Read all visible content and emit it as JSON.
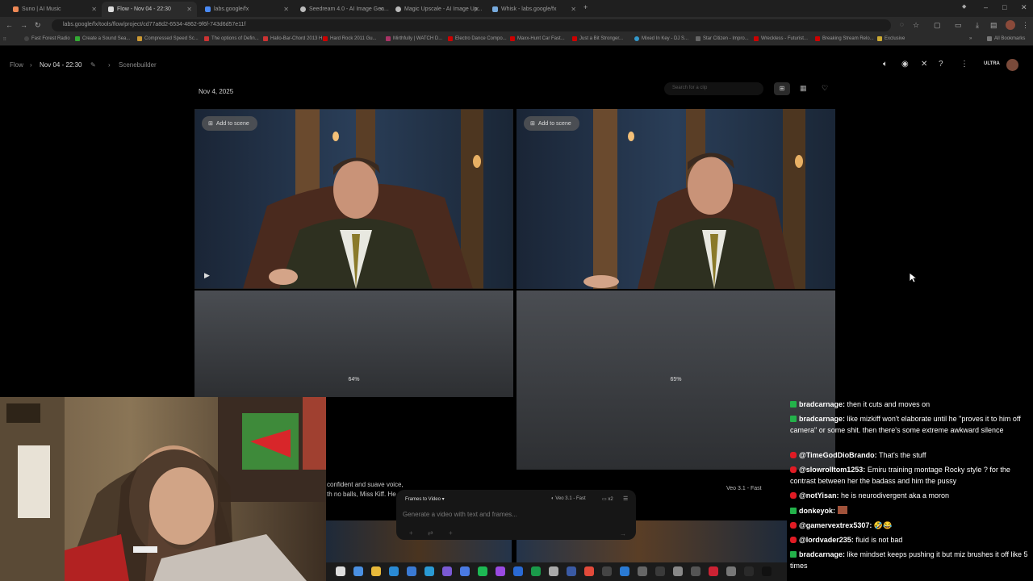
{
  "browser": {
    "tabs": [
      {
        "title": "Suno | AI Music",
        "active": false
      },
      {
        "title": "Flow - Nov 04 - 22:30",
        "active": true
      },
      {
        "title": "labs.google/fx",
        "active": false
      },
      {
        "title": "Seedream 4.0 - AI Image Gen...",
        "active": false
      },
      {
        "title": "Magic Upscale - AI Image Up...",
        "active": false
      },
      {
        "title": "Whisk - labs.google/fx",
        "active": false
      }
    ],
    "new_tab": "+",
    "url": "labs.google/fx/tools/flow/project/cd77a8d2-6534-4862-9f6f-743d6d57e11f",
    "bookmarks": [
      "Fast Forest Radio",
      "Create a Sound Sea...",
      "Compressed Speed Sc...",
      "The options of Defin...",
      "Hallo-Bar-Chord 2013 H...",
      "Hard Rock 2011 Gu...",
      "Mirthfully | WATCH D...",
      "Electro Dance Compo...",
      "Maxx-Hunt Car Fast...",
      "Just a Bit Stronger...",
      "Mixed In Key - DJ S...",
      "Star Citizen - Impro...",
      "Wreckless - Futurist...",
      "Breaking Stream Relo...",
      "Exclusive"
    ],
    "all_bookmarks": "All Bookmarks"
  },
  "app": {
    "breadcrumb": [
      "Flow",
      "Nov 04 - 22:30",
      "Scenebuilder"
    ],
    "date_label": "Nov 4, 2025",
    "search_placeholder": "Search for a clip",
    "badge": "ULTRA",
    "add_to_scene": "Add to scene",
    "progress": [
      {
        "label": "64%",
        "value": 64
      },
      {
        "label": "65%",
        "value": 65
      }
    ],
    "model_label": "Veo 3.1 - Fast",
    "overlay_text": [
      "confident and suave voice,",
      "th no balls, Miss Kiff. He"
    ],
    "prompt": {
      "mode": "Frames to Video",
      "model": "Veo 3.1 - Fast",
      "count": "x2",
      "placeholder": "Generate a video with text and frames..."
    }
  },
  "chat": [
    {
      "user": "bradcarnage:",
      "text": "then it cuts and moves on",
      "badge": "green"
    },
    {
      "user": "bradcarnage:",
      "text": "like mizkiff won't elaborate until he \"proves it to him off camera\" or some shit. then there's some extreme awkward silence",
      "badge": "green"
    },
    {
      "user": "@TimeGodDioBrando:",
      "text": "That's the stuff",
      "badge": "red"
    },
    {
      "user": "@slowrolltom1253:",
      "text": "Emiru training montage Rocky style ? for the contrast between her the badass and him the pussy",
      "badge": "red"
    },
    {
      "user": "@notYisan:",
      "text": "he is neurodivergent aka a moron",
      "badge": "red"
    },
    {
      "user": "donkeyok:",
      "text": "",
      "badge": "green"
    },
    {
      "user": "@gamervextrex5307:",
      "text": "🤣😂",
      "badge": "red"
    },
    {
      "user": "@lordvader235:",
      "text": "fluid is not bad",
      "badge": "red"
    },
    {
      "user": "bradcarnage:",
      "text": "like mindset keeps pushing it but miz brushes it off like 5 times",
      "badge": "green"
    }
  ],
  "colors": {
    "accent_green": "#23b24a",
    "accent_red": "#e01b24"
  }
}
